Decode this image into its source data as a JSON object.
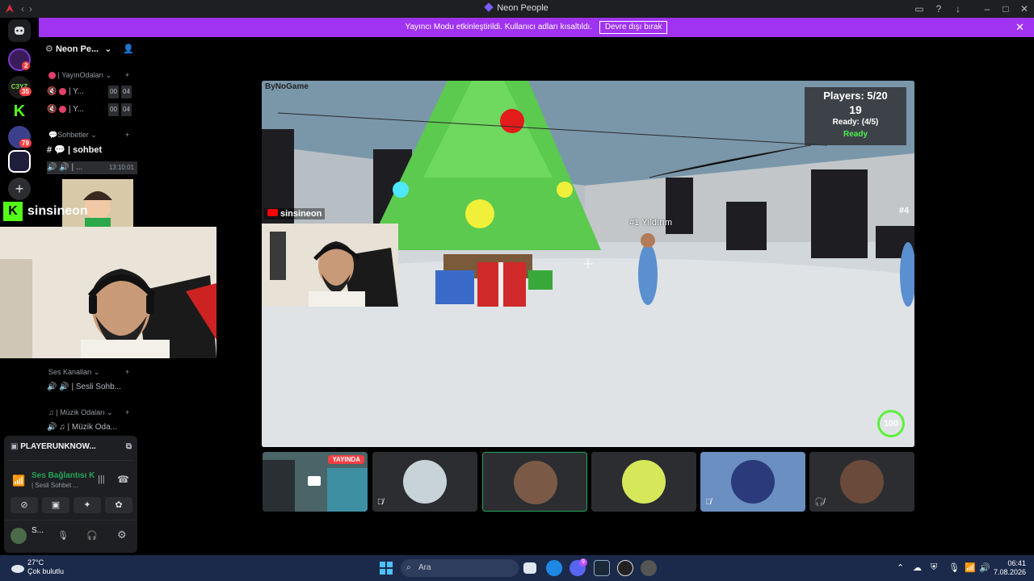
{
  "window": {
    "title": "Neon People"
  },
  "banner": {
    "text": "Yayıncı Modu etkinleştirildi. Kullanıcı adları kısaltıldı.",
    "button": "Devre dışı bırak"
  },
  "rail": {
    "badges": [
      "2",
      "35",
      "79"
    ]
  },
  "guild": {
    "name": "Neon Pe...",
    "categories": {
      "stream_rooms": "| YayınOdaları",
      "chats": "Sohbetler",
      "voice": "Ses Kanalları",
      "music": "| Müzik Odaları"
    },
    "channels": {
      "stream1": "| Y...",
      "stream1_counts": [
        "00",
        "04"
      ],
      "stream2": "| Y...",
      "stream2_counts": [
        "00",
        "04"
      ],
      "chat": "| sohbet",
      "active_voice": "| ...",
      "active_timer": "13:10:01",
      "voice_chat": "| Sesli Sohb...",
      "music_room": "Müzik Oda..."
    }
  },
  "streamer": {
    "name": "sinsineon"
  },
  "voice_panel": {
    "game": "PLAYERUNKNOW...",
    "connection": "Ses Bağlantısı K",
    "sub": "| Sesli Sohbet ...",
    "user": "S..."
  },
  "stream": {
    "brand": "ByNoGame",
    "youtube_name": "sinsineon",
    "hud": {
      "players": "Players: 5/20",
      "count": "19",
      "ready_count": "Ready: (4/5)",
      "ready": "Ready"
    },
    "player_tag": "#1 Yıldırım",
    "side_tag": "#4",
    "health": "100"
  },
  "participants": {
    "live_badge": "YAYINDA"
  },
  "taskbar": {
    "temp": "27°C",
    "weather": "Çok bulutlu",
    "search": "Ara",
    "discord_badge": "9",
    "time": "06:41",
    "date": "7.08.2026"
  }
}
